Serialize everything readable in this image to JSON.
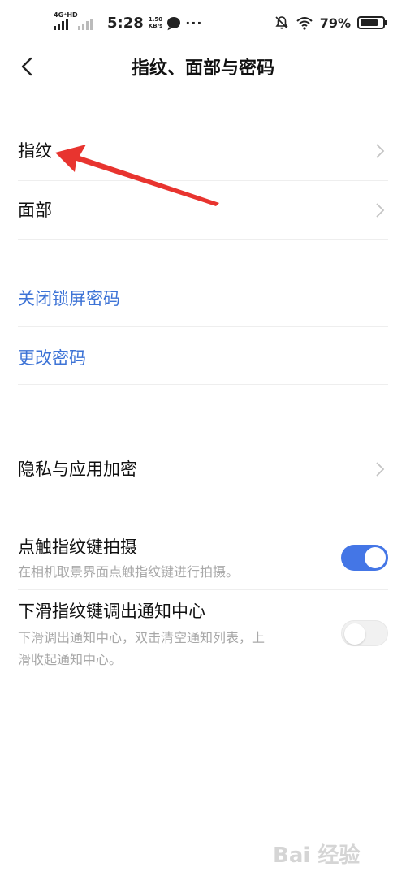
{
  "status_bar": {
    "network": "4G⁺HD",
    "time": "5:28",
    "speed_value": "1.50",
    "speed_unit": "KB/s",
    "more": "···",
    "battery": "79%",
    "battery_level": 0.79
  },
  "header": {
    "back_icon": "chevron-left-icon",
    "title": "指纹、面部与密码"
  },
  "items": {
    "fingerprint": {
      "label": "指纹",
      "icon": "chevron-right-icon"
    },
    "face": {
      "label": "面部",
      "icon": "chevron-right-icon"
    },
    "close_lock_password": {
      "label": "关闭锁屏密码"
    },
    "change_password": {
      "label": "更改密码"
    },
    "privacy": {
      "label": "隐私与应用加密",
      "icon": "chevron-right-icon"
    },
    "touch_shoot": {
      "label": "点触指纹键拍摄",
      "desc": "在相机取景界面点触指纹键进行拍摄。",
      "enabled": true
    },
    "swipe_notify": {
      "label": "下滑指纹键调出通知中心",
      "desc_line1": "下滑调出通知中心，双击清空通知列表，上",
      "desc_line2": "滑收起通知中心。",
      "enabled": false
    }
  },
  "colors": {
    "accent": "#4476e6",
    "link_blue": "#3d73d6",
    "annotation_arrow": "#e8342f"
  },
  "watermark": {
    "text": "Bai 经验"
  }
}
